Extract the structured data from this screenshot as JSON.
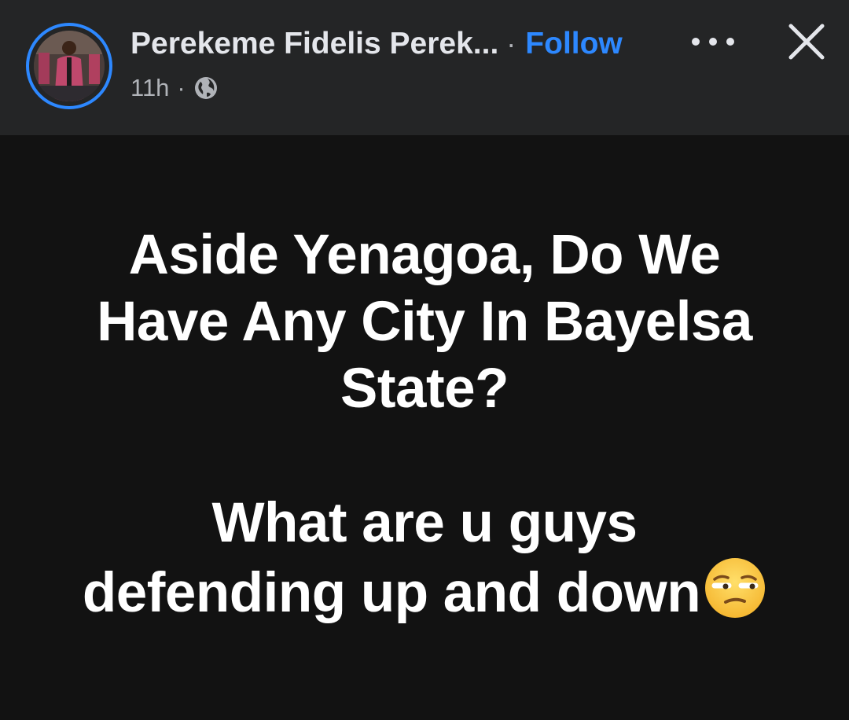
{
  "post": {
    "author": "Perekeme Fidelis Perek...",
    "separator": "·",
    "follow_label": "Follow",
    "time": "11h",
    "meta_separator": "·",
    "audience_icon": "globe-icon",
    "more_icon": "more-options-icon",
    "close_icon": "close-icon",
    "text_lines": [
      "Aside Yenagoa, Do We",
      "Have Any City In Bayelsa",
      "State?"
    ],
    "text_lines_2": [
      "What are u guys",
      "defending up and down"
    ],
    "emoji": "unamused-face-emoji"
  },
  "colors": {
    "header_bg": "#242526",
    "body_bg": "#121212",
    "accent": "#2d88ff",
    "text": "#ffffff"
  }
}
